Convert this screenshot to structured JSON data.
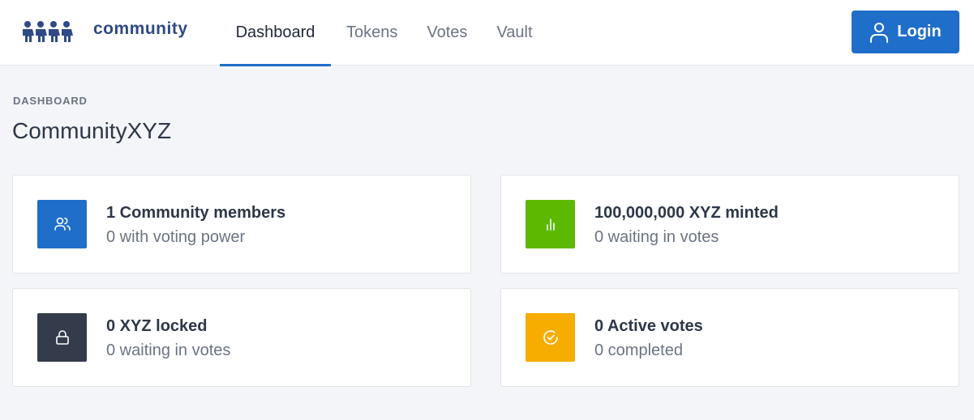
{
  "header": {
    "brand": "community",
    "logo_icon": "community-people-logo",
    "nav": [
      {
        "label": "Dashboard",
        "active": true
      },
      {
        "label": "Tokens",
        "active": false
      },
      {
        "label": "Votes",
        "active": false
      },
      {
        "label": "Vault",
        "active": false
      }
    ],
    "login": {
      "label": "Login",
      "icon": "user-icon"
    }
  },
  "page": {
    "section_label": "DASHBOARD",
    "title": "CommunityXYZ"
  },
  "cards": [
    {
      "icon": "users-icon",
      "color": "#1f6ec9",
      "title": "1 Community members",
      "subtitle": "0 with voting power"
    },
    {
      "icon": "bar-chart-icon",
      "color": "#5cb800",
      "title": "100,000,000 XYZ minted",
      "subtitle": "0 waiting in votes"
    },
    {
      "icon": "lock-icon",
      "color": "#343c4c",
      "title": "0 XYZ locked",
      "subtitle": "0 waiting in votes"
    },
    {
      "icon": "check-circle-icon",
      "color": "#f7ac00",
      "title": "0 Active votes",
      "subtitle": "0 completed"
    }
  ],
  "colors": {
    "accent": "#1f6ec9",
    "brand_text": "#2f4a86",
    "background": "#f4f5f8"
  }
}
